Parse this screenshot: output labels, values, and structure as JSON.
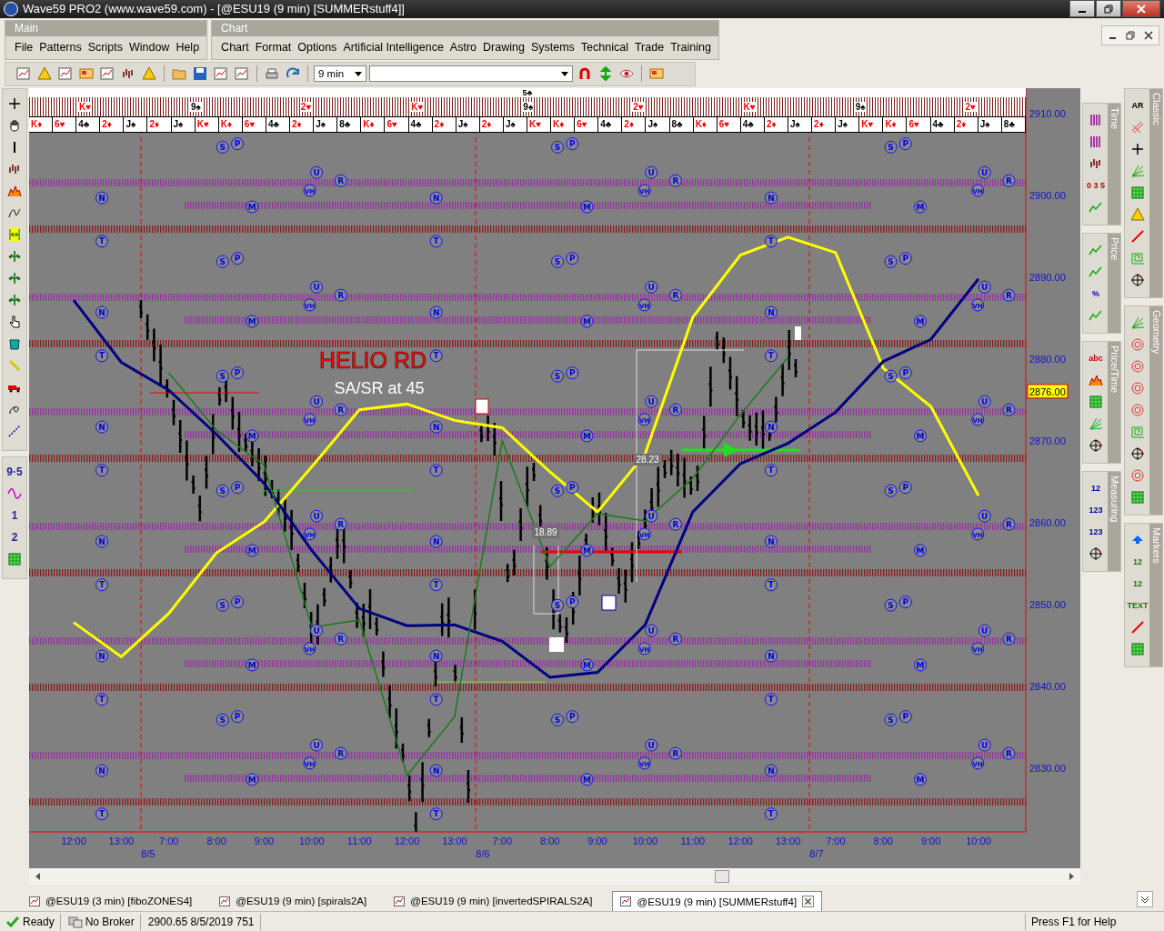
{
  "window": {
    "title": "Wave59 PRO2 (www.wave59.com) - [@ESU19 (9 min) [SUMMERstuff4]]"
  },
  "menus": [
    {
      "title": "Main",
      "items": [
        "File",
        "Patterns",
        "Scripts",
        "Window",
        "Help"
      ]
    },
    {
      "title": "Chart",
      "items": [
        "Chart",
        "Format",
        "Options",
        "Artificial Intelligence",
        "Astro",
        "Drawing",
        "Systems",
        "Technical",
        "Trade",
        "Training"
      ]
    }
  ],
  "toolbar": {
    "interval": "9 min"
  },
  "left_toolbar": [
    {
      "items": [
        {
          "kind": "icon"
        },
        {
          "kind": "icon"
        },
        {
          "kind": "icon"
        },
        {
          "kind": "icon"
        },
        {
          "kind": "icon"
        },
        {
          "kind": "icon"
        },
        {
          "kind": "icon"
        },
        {
          "kind": "icon"
        },
        {
          "kind": "icon"
        },
        {
          "kind": "icon"
        },
        {
          "kind": "icon"
        },
        {
          "kind": "icon"
        },
        {
          "kind": "icon"
        },
        {
          "kind": "icon"
        },
        {
          "kind": "icon"
        },
        {
          "kind": "icon"
        }
      ]
    },
    {
      "items": [
        {
          "kind": "text",
          "label": "9·5"
        },
        {
          "kind": "icon"
        },
        {
          "kind": "text",
          "label": "1"
        },
        {
          "kind": "text",
          "label": "2"
        },
        {
          "kind": "icon"
        }
      ]
    }
  ],
  "card_strip": {
    "top_labels": [
      "5♣"
    ],
    "mid_labels": [
      {
        "label": "K♥",
        "color": "#ff0000"
      },
      {
        "label": "9♠",
        "color": "#000000"
      },
      {
        "label": "2♥",
        "color": "#ff0000"
      },
      {
        "label": "K♥",
        "color": "#ff0000"
      },
      {
        "label": "9♠",
        "color": "#000000"
      },
      {
        "label": "2♥",
        "color": "#ff0000"
      },
      {
        "label": "K♥",
        "color": "#ff0000"
      },
      {
        "label": "9♠",
        "color": "#000000"
      },
      {
        "label": "2♥",
        "color": "#ff0000"
      }
    ],
    "cards": [
      {
        "label": "K♦",
        "color": "#ff0000"
      },
      {
        "label": "6♥",
        "color": "#ff0000"
      },
      {
        "label": "4♣",
        "color": "#000000"
      },
      {
        "label": "2♦",
        "color": "#ff0000"
      },
      {
        "label": "J♠",
        "color": "#000000"
      },
      {
        "label": "2♦",
        "color": "#ff0000"
      },
      {
        "label": "J♠",
        "color": "#000000"
      },
      {
        "label": "K♥",
        "color": "#ff0000"
      },
      {
        "label": "K♦",
        "color": "#ff0000"
      },
      {
        "label": "6♥",
        "color": "#ff0000"
      },
      {
        "label": "4♣",
        "color": "#000000"
      },
      {
        "label": "2♦",
        "color": "#ff0000"
      },
      {
        "label": "J♠",
        "color": "#000000"
      },
      {
        "label": "8♣",
        "color": "#000000"
      },
      {
        "label": "K♦",
        "color": "#ff0000"
      },
      {
        "label": "6♥",
        "color": "#ff0000"
      },
      {
        "label": "4♣",
        "color": "#000000"
      },
      {
        "label": "2♦",
        "color": "#ff0000"
      },
      {
        "label": "J♠",
        "color": "#000000"
      },
      {
        "label": "2♦",
        "color": "#ff0000"
      },
      {
        "label": "J♠",
        "color": "#000000"
      },
      {
        "label": "K♥",
        "color": "#ff0000"
      },
      {
        "label": "K♦",
        "color": "#ff0000"
      },
      {
        "label": "6♥",
        "color": "#ff0000"
      },
      {
        "label": "4♣",
        "color": "#000000"
      },
      {
        "label": "2♦",
        "color": "#ff0000"
      },
      {
        "label": "J♠",
        "color": "#000000"
      },
      {
        "label": "8♣",
        "color": "#000000"
      },
      {
        "label": "K♦",
        "color": "#ff0000"
      },
      {
        "label": "6♥",
        "color": "#ff0000"
      },
      {
        "label": "4♣",
        "color": "#000000"
      },
      {
        "label": "2♦",
        "color": "#ff0000"
      },
      {
        "label": "J♠",
        "color": "#000000"
      },
      {
        "label": "2♦",
        "color": "#ff0000"
      },
      {
        "label": "J♠",
        "color": "#000000"
      },
      {
        "label": "K♥",
        "color": "#ff0000"
      },
      {
        "label": "K♦",
        "color": "#ff0000"
      },
      {
        "label": "6♥",
        "color": "#ff0000"
      },
      {
        "label": "4♣",
        "color": "#000000"
      },
      {
        "label": "2♦",
        "color": "#ff0000"
      },
      {
        "label": "J♠",
        "color": "#000000"
      },
      {
        "label": "8♣",
        "color": "#000000"
      }
    ]
  },
  "chart": {
    "last_price": "2876.00",
    "dates": [
      "8/5",
      "8/6",
      "8/7"
    ],
    "astro_markers": [
      "N",
      "T",
      "N",
      "T",
      "N",
      "T",
      "N",
      "T",
      "N",
      "T",
      "N",
      "T",
      "S",
      "S",
      "S",
      "S",
      "S",
      "S",
      "P",
      "P",
      "P",
      "P",
      "P",
      "P",
      "M",
      "M",
      "M",
      "M",
      "M",
      "M",
      "VH",
      "VH",
      "VH",
      "VH",
      "VH",
      "VH",
      "U",
      "U",
      "U",
      "U",
      "U",
      "U",
      "R",
      "R",
      "R",
      "R",
      "R",
      "R",
      "N",
      "T",
      "N",
      "T",
      "N",
      "T",
      "N",
      "T",
      "N",
      "T",
      "N",
      "T",
      "S",
      "S",
      "S",
      "S",
      "S",
      "S",
      "P",
      "P",
      "P",
      "P",
      "P",
      "P",
      "M",
      "M",
      "M",
      "M",
      "M",
      "M",
      "VH",
      "VH",
      "VH",
      "VH",
      "VH",
      "VH",
      "U",
      "U",
      "U",
      "U",
      "U",
      "U",
      "R",
      "R",
      "R",
      "R",
      "R",
      "R",
      "N",
      "T",
      "N",
      "T",
      "N",
      "T",
      "N",
      "T",
      "N",
      "T",
      "N",
      "T",
      "S",
      "S",
      "S",
      "S",
      "S",
      "S",
      "P",
      "P",
      "P",
      "P",
      "P",
      "P",
      "M",
      "M",
      "M",
      "M",
      "M",
      "M",
      "VH",
      "VH",
      "VH",
      "VH",
      "VH",
      "VH",
      "U",
      "U",
      "U",
      "U",
      "U",
      "U",
      "R",
      "R",
      "R",
      "R",
      "R",
      "R"
    ],
    "chart_data": {
      "type": "line",
      "categories": [
        "12:00",
        "13:00",
        "7:00",
        "8:00",
        "9:00",
        "10:00",
        "11:00",
        "12:00",
        "13:00",
        "7:00",
        "8:00",
        "9:00",
        "10:00",
        "11:00",
        "12:00",
        "13:00",
        "7:00",
        "8:00",
        "9:00",
        "10:00"
      ],
      "series": [
        {
          "color": "#ffff00",
          "values": [
            2847.8,
            2843.6,
            2848.9,
            2856.3,
            2860.1,
            2866.8,
            2873.8,
            2874.5,
            2872.5,
            2871.6,
            2866.2,
            2861.3,
            2868.4,
            2885.1,
            2892.7,
            2894.9,
            2893.0,
            2878.9,
            2874.2,
            2863.3
          ]
        },
        {
          "color": "#000080",
          "values": [
            2887.2,
            2879.6,
            2876.2,
            2870.8,
            2864.8,
            2856.6,
            2849.5,
            2847.4,
            2847.5,
            2845.5,
            2841.1,
            2841.7,
            2847.5,
            2861.3,
            2867.2,
            2869.7,
            2873.5,
            2879.7,
            2882.4,
            2889.8
          ]
        },
        {
          "color": "#1a7a1a",
          "values": [
            null,
            null,
            2878.3,
            2871.3,
            2867.0,
            2847.2,
            2848.1,
            2829.1,
            2836.3,
            2870.0,
            2854.6,
            2861.1,
            2860.2,
            2865.4,
            2873.2,
            2880.2,
            null,
            null,
            null,
            null
          ]
        }
      ],
      "ylim": [
        2822.2,
        2913.1
      ],
      "yticks": [
        {
          "value": 2830,
          "label": "2830.00"
        },
        {
          "value": 2840,
          "label": "2840.00"
        },
        {
          "value": 2850,
          "label": "2850.00"
        },
        {
          "value": 2860,
          "label": "2860.00"
        },
        {
          "value": 2870,
          "label": "2870.00"
        },
        {
          "value": 2880,
          "label": "2880.00"
        },
        {
          "value": 2890,
          "label": "2890.00"
        },
        {
          "value": 2900,
          "label": "2900.00"
        },
        {
          "value": 2910,
          "label": "2910.00"
        }
      ],
      "annotations": [
        "HELIO RD",
        "SA/SR at 45",
        "18.89",
        "28.23"
      ]
    }
  },
  "palettes": [
    {
      "title": "Time",
      "items": [
        {
          "kind": "icon"
        },
        {
          "kind": "icon"
        },
        {
          "kind": "icon"
        },
        {
          "kind": "text",
          "label": "0 3 5"
        },
        {
          "kind": "icon"
        }
      ]
    },
    {
      "title": "Price",
      "items": [
        {
          "kind": "icon"
        },
        {
          "kind": "icon"
        },
        {
          "kind": "text",
          "label": "%"
        },
        {
          "kind": "icon"
        }
      ]
    },
    {
      "title": "Price/Time",
      "items": [
        {
          "kind": "text",
          "label": "abc"
        },
        {
          "kind": "icon"
        },
        {
          "kind": "icon"
        },
        {
          "kind": "icon"
        },
        {
          "kind": "icon"
        }
      ]
    },
    {
      "title": "Measuring",
      "items": [
        {
          "kind": "text",
          "label": "12"
        },
        {
          "kind": "text",
          "label": "123"
        },
        {
          "kind": "text",
          "label": "123"
        },
        {
          "kind": "icon"
        }
      ]
    },
    {
      "title": "Classic",
      "items": [
        {
          "kind": "text",
          "label": "AR"
        },
        {
          "kind": "icon"
        },
        {
          "kind": "icon"
        },
        {
          "kind": "icon"
        },
        {
          "kind": "icon"
        },
        {
          "kind": "icon"
        },
        {
          "kind": "icon"
        },
        {
          "kind": "icon"
        },
        {
          "kind": "icon"
        }
      ]
    },
    {
      "title": "Geometry",
      "items": [
        {
          "kind": "icon"
        },
        {
          "kind": "icon"
        },
        {
          "kind": "icon"
        },
        {
          "kind": "icon"
        },
        {
          "kind": "icon"
        },
        {
          "kind": "icon"
        },
        {
          "kind": "icon"
        },
        {
          "kind": "icon"
        },
        {
          "kind": "icon"
        }
      ]
    },
    {
      "title": "Markers",
      "items": [
        {
          "kind": "icon"
        },
        {
          "kind": "text",
          "label": "12"
        },
        {
          "kind": "text",
          "label": "12"
        },
        {
          "kind": "text",
          "label": "TEXT"
        },
        {
          "kind": "icon"
        },
        {
          "kind": "icon"
        }
      ]
    }
  ],
  "tabs": [
    {
      "label": "@ESU19 (3 min) [fiboZONES4]",
      "selected": false
    },
    {
      "label": "@ESU19 (9 min) [spirals2A]",
      "selected": false
    },
    {
      "label": "@ESU19 (9 min) [invertedSPIRALS2A]",
      "selected": false
    },
    {
      "label": "@ESU19 (9 min) [SUMMERstuff4]",
      "selected": true
    }
  ],
  "status_bar": {
    "state": "Ready",
    "broker": "No Broker",
    "quote": "2900.65 8/5/2019 751",
    "help": "Press F1 for Help"
  }
}
